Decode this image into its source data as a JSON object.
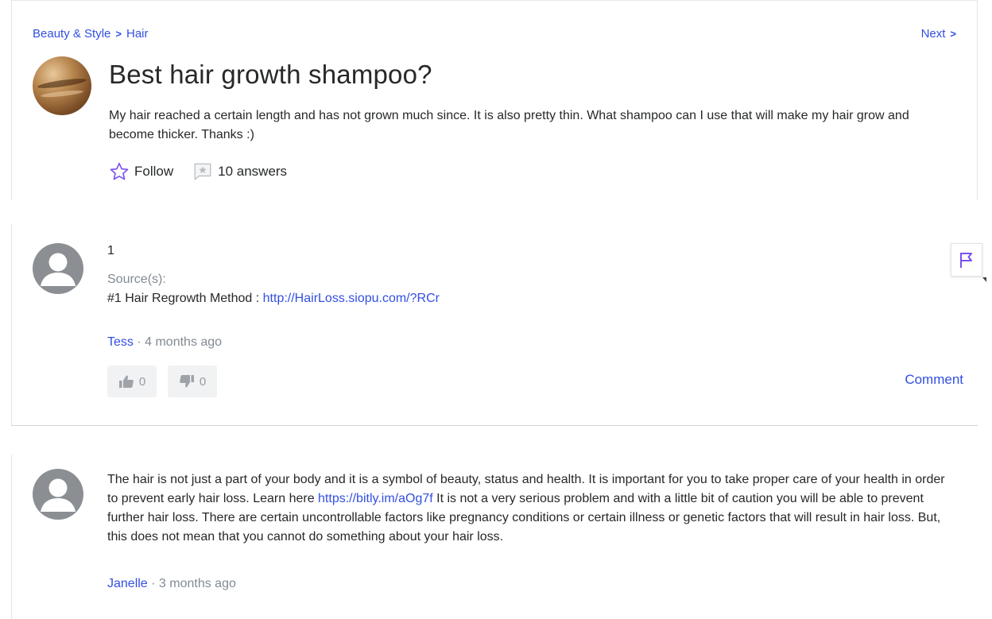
{
  "breadcrumb": {
    "category": "Beauty & Style",
    "subcategory": "Hair",
    "separator": ">"
  },
  "nav": {
    "next_label": "Next",
    "next_chevron": ">"
  },
  "question": {
    "title": "Best hair growth shampoo?",
    "body": "My hair reached a certain length and has not grown much since. It is also pretty thin. What shampoo can I use that will make my hair grow and become thicker. Thanks :)",
    "follow_label": "Follow",
    "answers_label": "10 answers",
    "follow_icon": "star-outline-icon",
    "answers_icon": "answer-bubble-icon"
  },
  "answers": [
    {
      "text": "1",
      "source_label": "Source(s):",
      "source_text": "#1 Hair Regrowth Method : ",
      "source_link": "http://HairLoss.siopu.com/?RCr",
      "author": "Tess",
      "time": " · 4 months ago",
      "upvotes": "0",
      "downvotes": "0",
      "comment_label": "Comment"
    },
    {
      "text_before": "The hair is not just a part of your body and it is a symbol of beauty, status and health. It is important for you to take proper care of your health in order to prevent early hair loss. Learn here ",
      "link": "https://bitly.im/aOg7f",
      "text_after": " It is not a very serious problem and with a little bit of caution you will be able to prevent further hair loss. There are certain uncontrollable factors like pregnancy conditions or certain illness or genetic factors that will result in hair loss. But, this does not mean that you cannot do something about your hair loss.",
      "author": "Janelle",
      "time": " · 3 months ago"
    }
  ],
  "colors": {
    "link": "#324fe1",
    "accent_purple": "#7b4ff0",
    "meta_gray": "#828a93"
  }
}
